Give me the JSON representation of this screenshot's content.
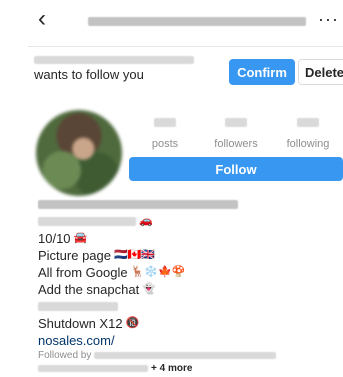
{
  "request": {
    "message": "wants to follow you",
    "confirm_label": "Confirm",
    "delete_label": "Delete"
  },
  "profile": {
    "stats": [
      {
        "label": "posts"
      },
      {
        "label": "followers"
      },
      {
        "label": "following"
      }
    ],
    "follow_label": "Follow"
  },
  "bio": {
    "line3": "10/10",
    "line4": "Picture page",
    "line5": "All from Google",
    "line6": "Add the snapchat",
    "line8": "Shutdown X12",
    "link": "nosales.com/",
    "followed_by": "Followed by",
    "more": "+ 4 more"
  },
  "icons": {
    "back": "chevron-left-icon",
    "more": "more-horizontal-icon"
  },
  "colors": {
    "accent": "#3897f0",
    "link": "#003569",
    "muted": "#8e8e8e"
  }
}
